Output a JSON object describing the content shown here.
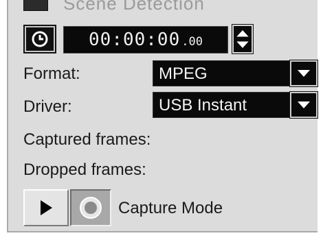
{
  "scene_detection": {
    "label": "Scene Detection"
  },
  "timecode": {
    "main": "00:00:00",
    "frames": ".00"
  },
  "format": {
    "label": "Format:",
    "value": "MPEG"
  },
  "driver": {
    "label": "Driver:",
    "value": "USB Instant"
  },
  "stats": {
    "captured_label": "Captured frames:",
    "dropped_label": "Dropped frames:"
  },
  "capture": {
    "mode_label": "Capture Mode"
  },
  "icons": {
    "timer": "clock-icon",
    "spinner": "up-down-arrows-icon",
    "dropdown": "chevron-down-icon",
    "play": "play-icon",
    "record": "record-icon"
  },
  "colors": {
    "panel_bg": "#dcdcdc",
    "field_bg": "#0a0a0a",
    "field_text": "#f5f5f5",
    "label_text": "#1a1a1a"
  }
}
